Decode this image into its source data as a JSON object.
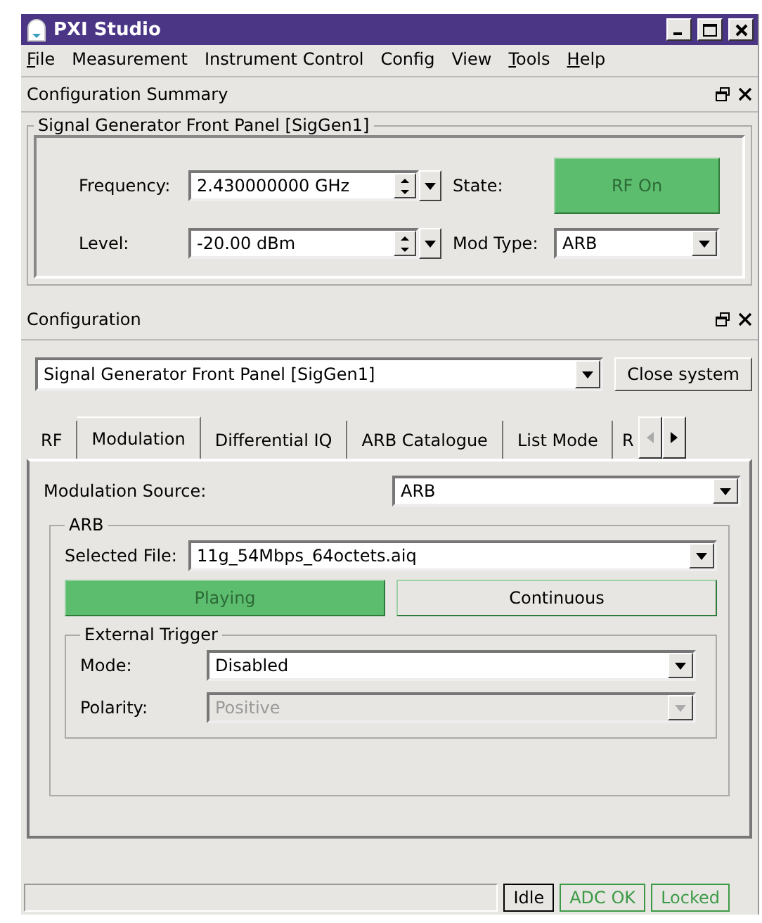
{
  "window": {
    "title": "PXI Studio"
  },
  "menu": [
    {
      "label": "File",
      "underline_first": true
    },
    {
      "label": "Measurement",
      "underline_first": false
    },
    {
      "label": "Instrument Control",
      "underline_first": false
    },
    {
      "label": "Config",
      "underline_first": false
    },
    {
      "label": "View",
      "underline_first": false
    },
    {
      "label": "Tools",
      "underline_first": true
    },
    {
      "label": "Help",
      "underline_first": true
    }
  ],
  "summary": {
    "title": "Configuration Summary",
    "group": "Signal Generator Front Panel [SigGen1]",
    "frequency": {
      "label": "Frequency:",
      "value": "2.430000000 GHz"
    },
    "level": {
      "label": "Level:",
      "value": "-20.00 dBm"
    },
    "state": {
      "label": "State:",
      "button": "RF On",
      "on": true
    },
    "mod_type": {
      "label": "Mod Type:",
      "value": "ARB"
    }
  },
  "configuration": {
    "title": "Configuration",
    "system": "Signal Generator Front Panel [SigGen1]",
    "close_button": "Close system",
    "tabs": [
      {
        "label": "RF",
        "selected": false
      },
      {
        "label": "Modulation",
        "selected": true
      },
      {
        "label": "Differential IQ",
        "selected": false
      },
      {
        "label": "ARB Catalogue",
        "selected": false
      },
      {
        "label": "List Mode",
        "selected": false
      },
      {
        "label": "R",
        "selected": false
      }
    ],
    "tab_scroll": {
      "left_disabled": true,
      "right_disabled": false
    },
    "modulation_source": {
      "label": "Modulation Source:",
      "value": "ARB"
    },
    "arb": {
      "title": "ARB",
      "file_label": "Selected File:",
      "file": "11g_54Mbps_64octets.aiq",
      "buttons": [
        {
          "label": "Playing",
          "on": true
        },
        {
          "label": "Continuous",
          "on": false
        }
      ],
      "trigger": {
        "title": "External Trigger",
        "fields": [
          {
            "label": "Mode:",
            "value": "Disabled",
            "disabled": false
          },
          {
            "label": "Polarity:",
            "value": "Positive",
            "disabled": true
          }
        ]
      }
    }
  },
  "status_bar": [
    {
      "label": "Idle",
      "color": "#000000"
    },
    {
      "label": "ADC OK",
      "color": "#3c9a46"
    },
    {
      "label": "Locked",
      "color": "#3c9a46"
    }
  ]
}
